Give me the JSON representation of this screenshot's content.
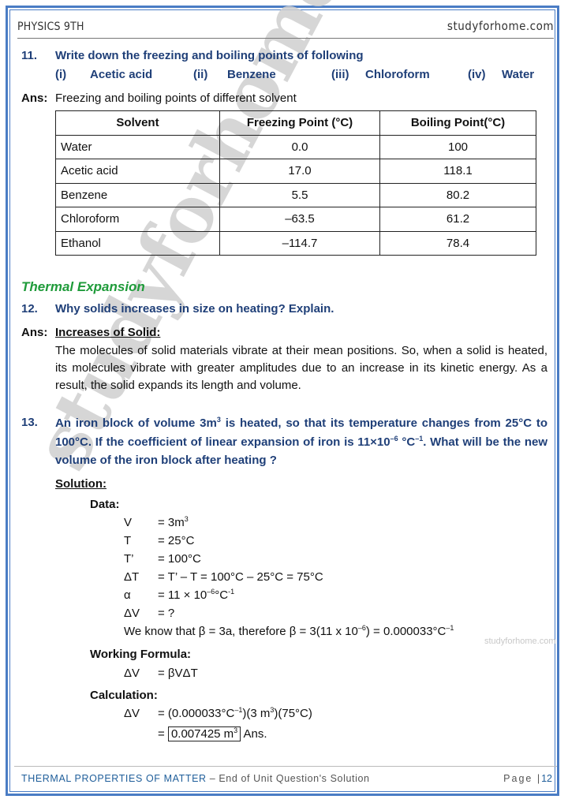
{
  "header": {
    "left": "PHYSICS 9TH",
    "right": "studyforhome.com"
  },
  "footer": {
    "chapter": "THERMAL PROPERTIES OF MATTER",
    "subtitle": " – End of Unit Question's Solution",
    "page_label": "Page ",
    "page_sep": "|",
    "page_number": "12"
  },
  "watermark": {
    "main": "studyforhome.com",
    "small": "studyforhome.com"
  },
  "q11": {
    "number": "11.",
    "text": "Write down the freezing and boiling points of following",
    "options": [
      {
        "num": "(i)",
        "label": "Acetic acid"
      },
      {
        "num": "(ii)",
        "label": "Benzene"
      },
      {
        "num": "(iii)",
        "label": "Chloroform"
      },
      {
        "num": "(iv)",
        "label": "Water"
      }
    ],
    "ans_label": "Ans:",
    "ans_text": "Freezing and boiling points of different solvent",
    "table": {
      "headers": [
        "Solvent",
        "Freezing Point (°C)",
        "Boiling Point(°C)"
      ],
      "rows": [
        [
          "Water",
          "0.0",
          "100"
        ],
        [
          "Acetic acid",
          "17.0",
          "118.1"
        ],
        [
          "Benzene",
          "5.5",
          "80.2"
        ],
        [
          "Chloroform",
          "–63.5",
          "61.2"
        ],
        [
          "Ethanol",
          "–114.7",
          "78.4"
        ]
      ]
    }
  },
  "section_title": "Thermal Expansion",
  "q12": {
    "number": "12.",
    "text": "Why solids increases in size on heating? Explain.",
    "ans_label": "Ans:",
    "heading": "Increases of Solid:",
    "body": "The molecules of solid materials vibrate at their mean positions. So, when a solid is heated, its molecules vibrate with greater amplitudes due to an increase in its kinetic energy. As a result, the solid expands its length and volume."
  },
  "q13": {
    "number": "13.",
    "text_parts": {
      "a": "An iron block of volume 3m",
      "a_sup": "3",
      "b": " is heated, so that its temperature changes from 25°C to 100°C. If the coefficient of linear expansion of iron is 11×10",
      "b_sup": "–6",
      "c": " °C",
      "c_sup": "–1",
      "d": ". What will be the new volume of the iron block after heating ?"
    },
    "solution_label": "Solution:",
    "data_label": "Data:",
    "data": [
      {
        "sym": "V",
        "eq": "= 3m",
        "sup": "3",
        "tail": ""
      },
      {
        "sym": "T",
        "eq": "= 25°C",
        "sup": "",
        "tail": ""
      },
      {
        "sym": "T’",
        "eq": "= 100°C",
        "sup": "",
        "tail": ""
      },
      {
        "sym": "ΔT",
        "eq": "= T’ – T = 100°C – 25°C = 75°C",
        "sup": "",
        "tail": ""
      },
      {
        "sym": "α",
        "eq": "=  11 × 10",
        "sup": "–6",
        "tail": "°C",
        "sup2": "-1"
      },
      {
        "sym": "ΔV",
        "eq": "= ?",
        "sup": "",
        "tail": ""
      }
    ],
    "note": {
      "a": "We know that β = 3a, therefore β = 3(11 x 10",
      "a_sup": "–6",
      "b": ") = 0.000033°C",
      "b_sup": "–1"
    },
    "formula_label": "Working Formula:",
    "formula": {
      "sym": "ΔV",
      "eq": "= βVΔT"
    },
    "calc_label": "Calculation:",
    "calc1": {
      "sym": "ΔV",
      "a": "= (0.000033°C",
      "a_sup": "–1",
      "b": ")(3 m",
      "b_sup": "3",
      "c": ")(75°C)"
    },
    "calc2": {
      "prefix": "=",
      "boxed": "0.007425 m",
      "boxed_sup": "3",
      "suffix": "Ans."
    }
  }
}
